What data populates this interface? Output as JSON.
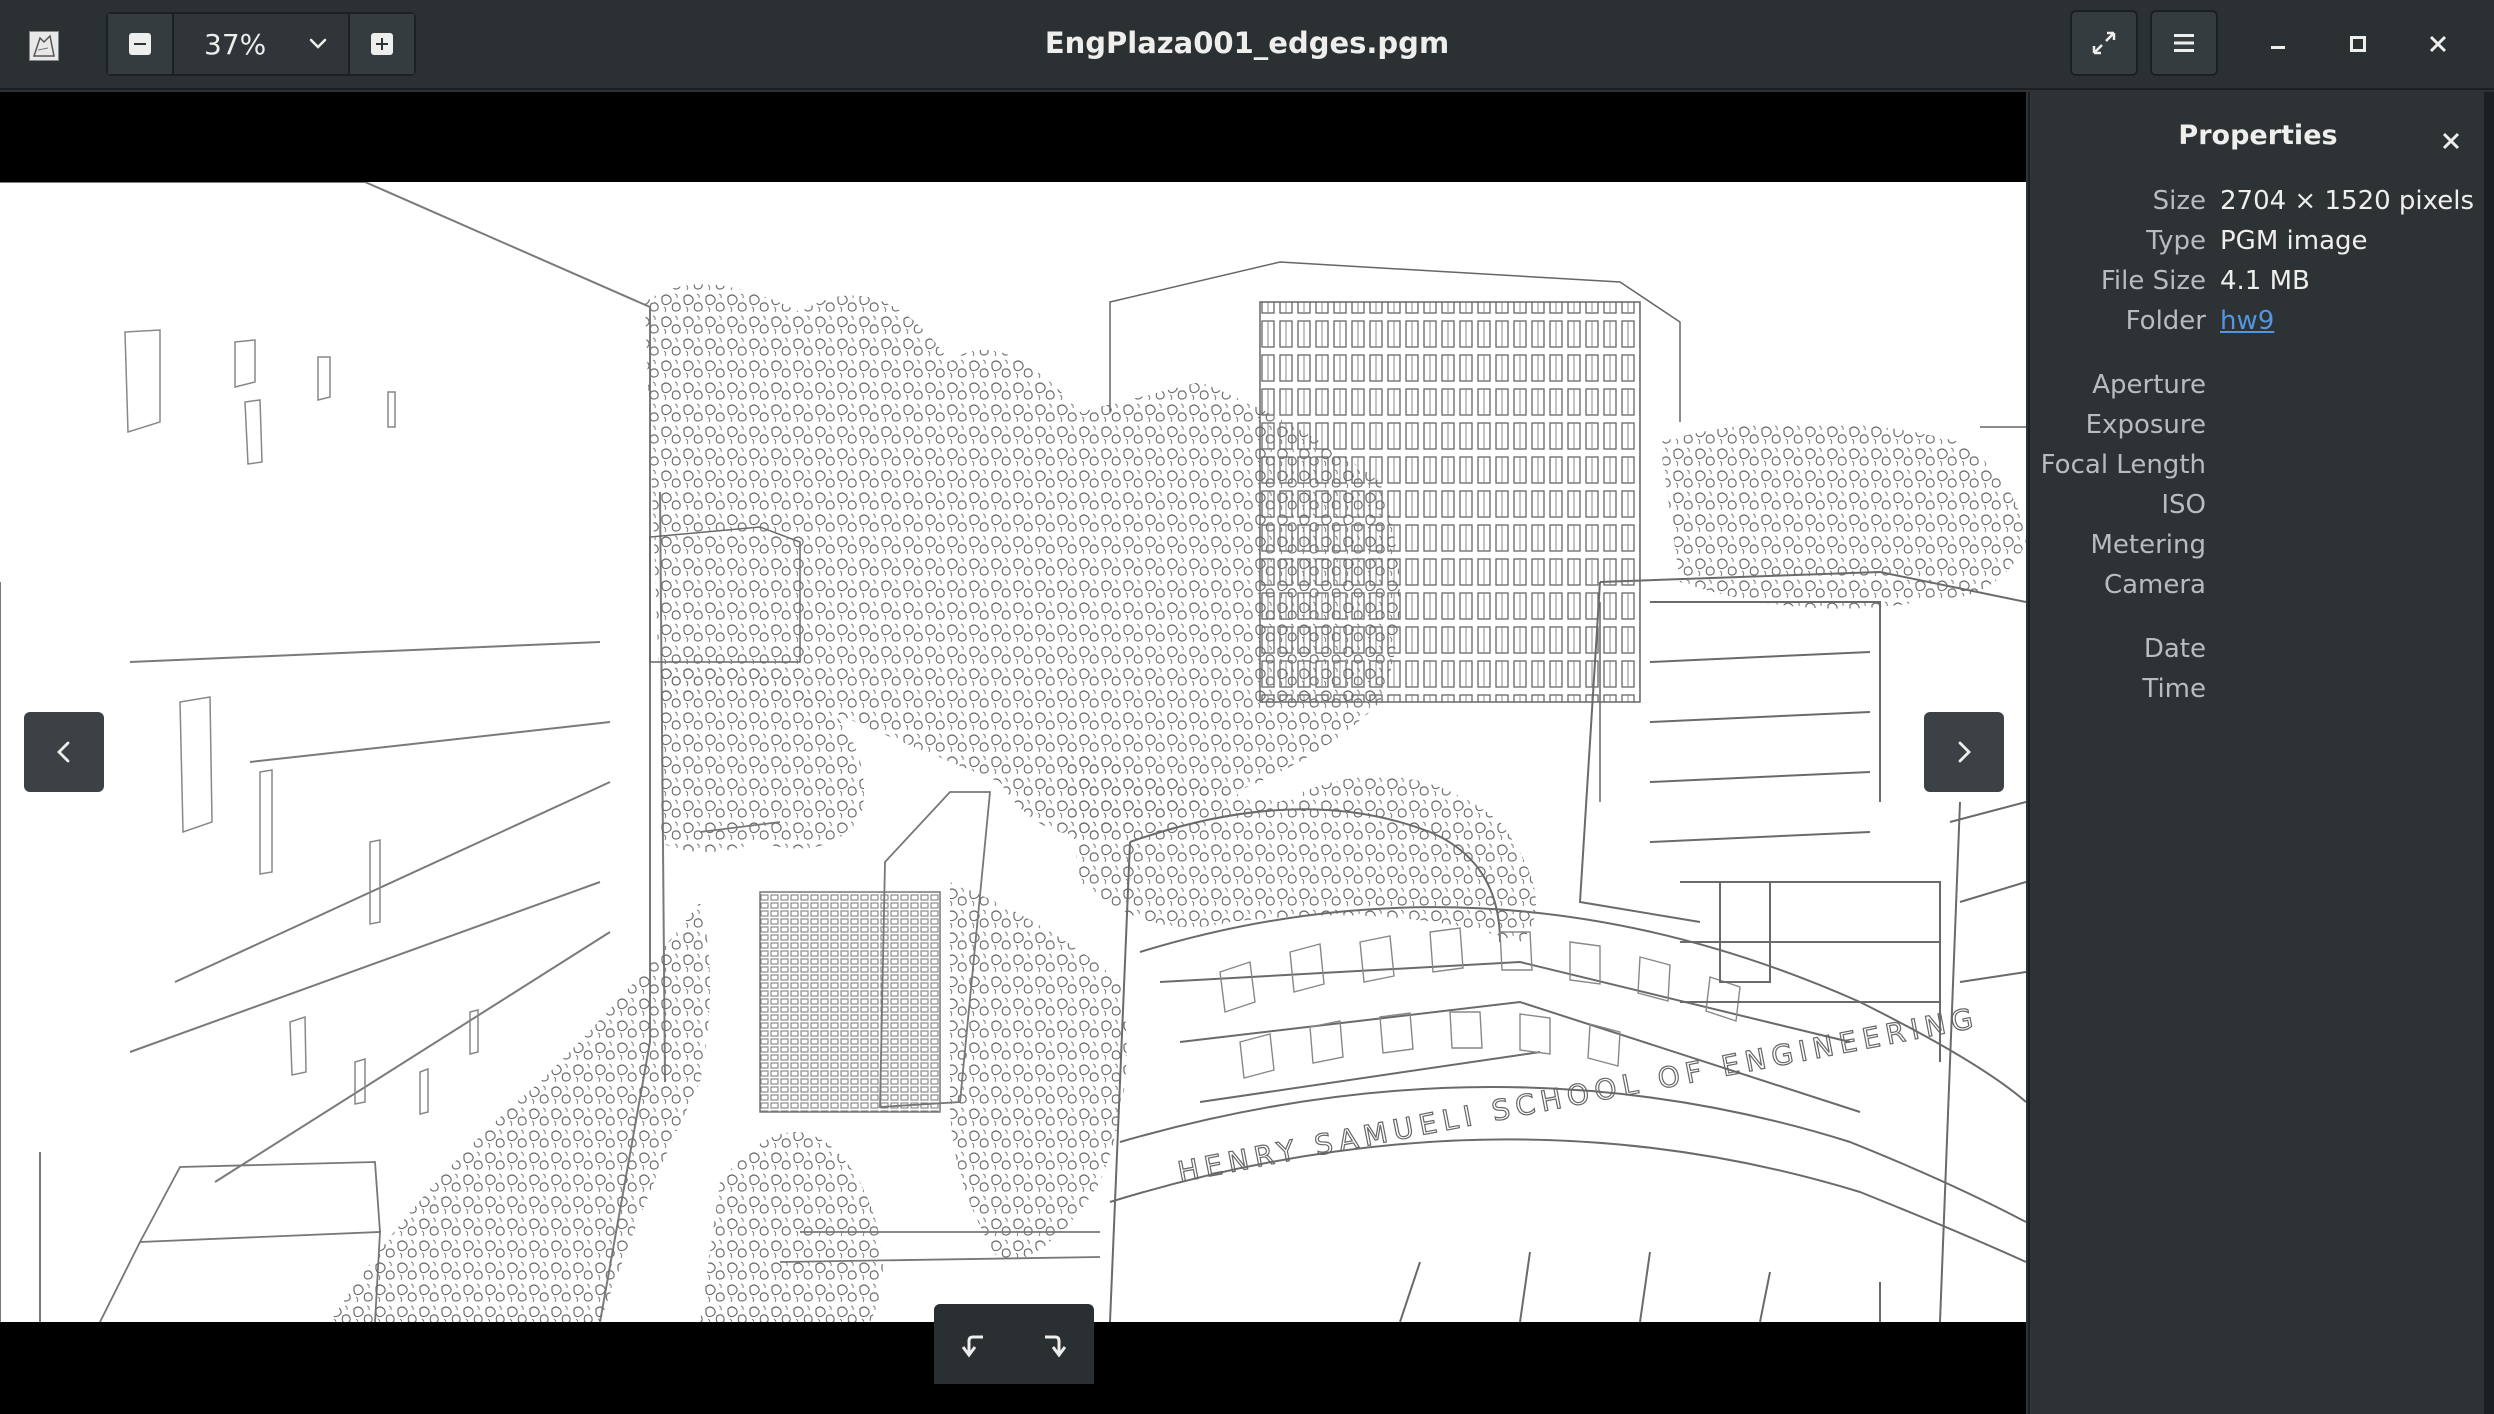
{
  "window": {
    "title": "EngPlaza001_edges.pgm"
  },
  "toolbar": {
    "zoom_out_icon": "minus-icon",
    "zoom_level": "37%",
    "zoom_dropdown_icon": "chevron-down-icon",
    "zoom_in_icon": "plus-icon",
    "fullscreen_icon": "fullscreen-icon",
    "menu_icon": "hamburger-menu-icon"
  },
  "window_controls": {
    "minimize_icon": "minimize-icon",
    "maximize_icon": "maximize-icon",
    "close_icon": "close-icon"
  },
  "viewer": {
    "image_description_icon": "edge-detected-photo",
    "prev_icon": "chevron-left-icon",
    "next_icon": "chevron-right-icon",
    "rotate_left_icon": "rotate-left-icon",
    "rotate_right_icon": "rotate-right-icon",
    "sign_text": "HENRY SAMUELI SCHOOL OF ENGINEERING"
  },
  "properties": {
    "title": "Properties",
    "close_icon": "close-icon",
    "rows": [
      {
        "label": "Size",
        "value": "2704 × 1520 pixels"
      },
      {
        "label": "Type",
        "value": "PGM image"
      },
      {
        "label": "File Size",
        "value": "4.1 MB"
      },
      {
        "label": "Folder",
        "value": "hw9"
      },
      {
        "label": "Aperture",
        "value": ""
      },
      {
        "label": "Exposure",
        "value": ""
      },
      {
        "label": "Focal Length",
        "value": ""
      },
      {
        "label": "ISO",
        "value": ""
      },
      {
        "label": "Metering",
        "value": ""
      },
      {
        "label": "Camera",
        "value": ""
      },
      {
        "label": "Date",
        "value": ""
      },
      {
        "label": "Time",
        "value": ""
      }
    ]
  },
  "colors": {
    "headerbar": "#2b3033",
    "sidebar": "#2d3235",
    "link": "#5594e0",
    "viewport_bg": "#000000"
  }
}
